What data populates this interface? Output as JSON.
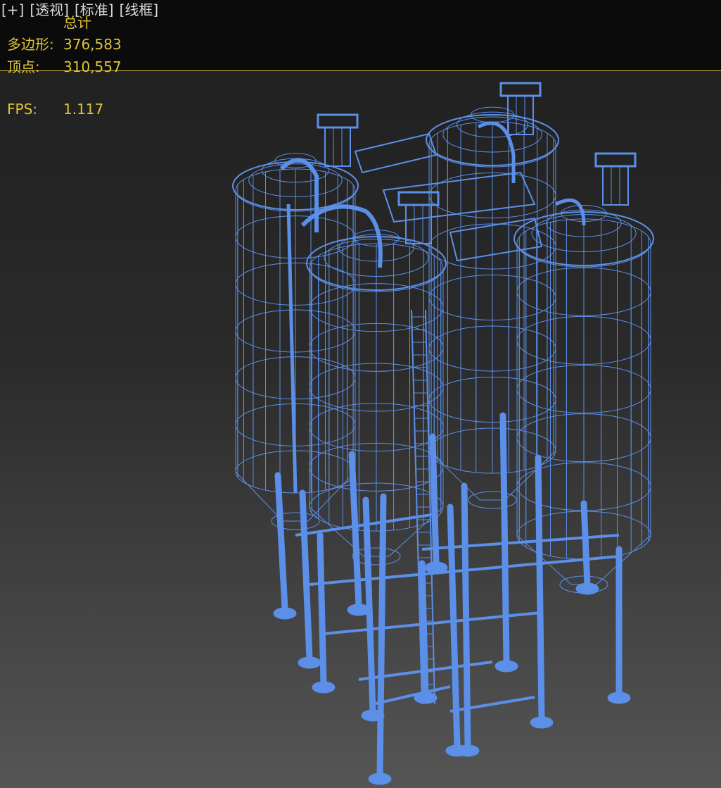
{
  "viewport_menu": {
    "plus": "[+]",
    "view": "[透视]",
    "shading_mode": "[标准]",
    "render_style": "[线框]"
  },
  "stats": {
    "header": "总计",
    "polygons_label": "多边形:",
    "polygons_value": "376,583",
    "vertices_label": "顶点:",
    "vertices_value": "310,557",
    "fps_label": "FPS:",
    "fps_value": "1.117"
  },
  "colors": {
    "wireframe": "#5b8fe8",
    "stats_text": "#e0c43a",
    "background_top": "#1f1f1f",
    "background_bottom": "#555555"
  },
  "scene": {
    "object": "wireframe-silo-array"
  }
}
